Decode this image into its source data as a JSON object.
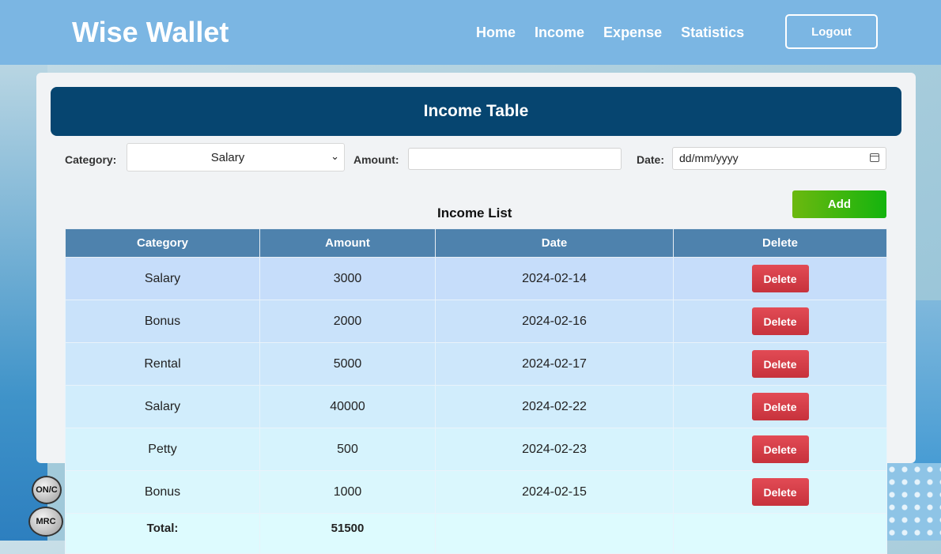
{
  "app": {
    "brand": "Wise Wallet"
  },
  "nav": {
    "items": [
      {
        "label": "Home"
      },
      {
        "label": "Income"
      },
      {
        "label": "Expense"
      },
      {
        "label": "Statistics"
      }
    ],
    "logout_label": "Logout"
  },
  "page": {
    "title": "Income Table",
    "list_title": "Income List"
  },
  "form": {
    "category_label": "Category:",
    "category_value": "Salary",
    "amount_label": "Amount:",
    "amount_value": "",
    "date_label": "Date:",
    "date_placeholder": "dd/mm/yyyy",
    "add_label": "Add"
  },
  "table": {
    "headers": [
      "Category",
      "Amount",
      "Date",
      "Delete"
    ],
    "delete_label": "Delete",
    "rows": [
      {
        "category": "Salary",
        "amount": "3000",
        "date": "2024-02-14"
      },
      {
        "category": "Bonus",
        "amount": "2000",
        "date": "2024-02-16"
      },
      {
        "category": "Rental",
        "amount": "5000",
        "date": "2024-02-17"
      },
      {
        "category": "Salary",
        "amount": "40000",
        "date": "2024-02-22"
      },
      {
        "category": "Petty",
        "amount": "500",
        "date": "2024-02-23"
      },
      {
        "category": "Bonus",
        "amount": "1000",
        "date": "2024-02-15"
      }
    ],
    "total_label": "Total:",
    "total_value": "51500"
  },
  "background": {
    "calc_keys": [
      "ON/C",
      "MRC"
    ]
  },
  "colors": {
    "header": "#7bb6e3",
    "title_bar": "#064570",
    "table_header": "#4e82ad",
    "add_button": "#14b40e",
    "delete_button": "#d8414b"
  }
}
